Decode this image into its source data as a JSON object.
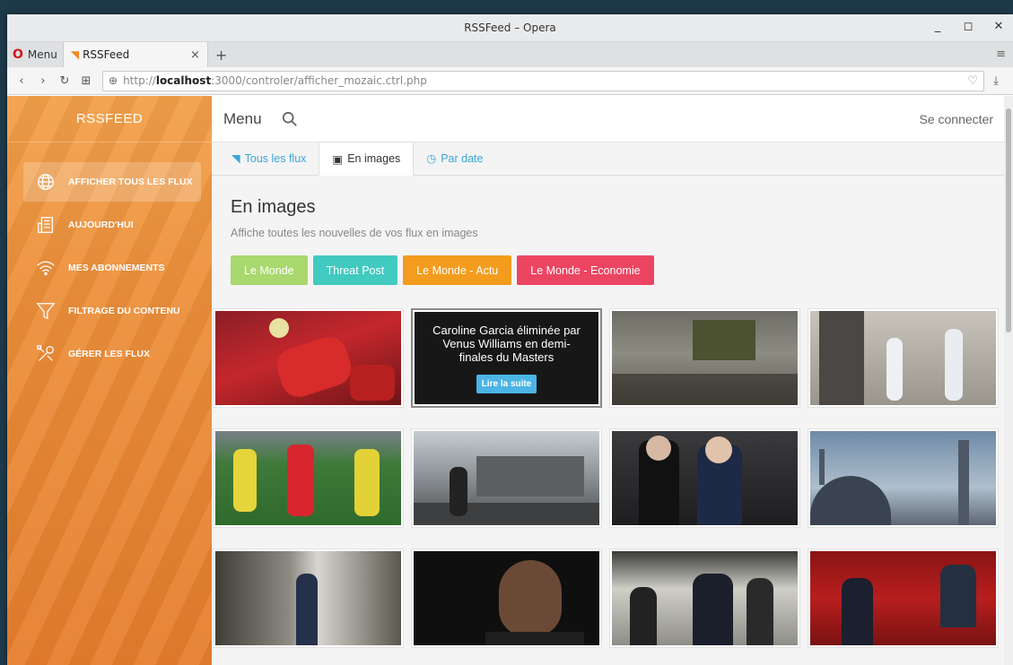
{
  "window": {
    "title": "RSSFeed – Opera"
  },
  "browser": {
    "menu_label": "Menu",
    "tab": {
      "title": "RSSFeed",
      "close": "×"
    },
    "new_tab": "+",
    "url": {
      "prefix": "http://",
      "host": "localhost",
      "rest": ":3000/controler/afficher_mozaic.ctrl.php"
    }
  },
  "sidebar": {
    "brand": "RSSFEED",
    "items": [
      {
        "label": "AFFICHER TOUS LES FLUX",
        "icon": "globe-icon",
        "active": true
      },
      {
        "label": "AUJOURD'HUI",
        "icon": "newspaper-icon",
        "active": false
      },
      {
        "label": "MES ABONNEMENTS",
        "icon": "wifi-icon",
        "active": false
      },
      {
        "label": "FILTRAGE DU CONTENU",
        "icon": "filter-icon",
        "active": false
      },
      {
        "label": "GÉRER LES FLUX",
        "icon": "tools-icon",
        "active": false
      }
    ]
  },
  "topnav": {
    "menu": "Menu",
    "login": "Se connecter"
  },
  "tabs": [
    {
      "label": "Tous les flux",
      "icon": "rss-icon",
      "active": false
    },
    {
      "label": "En images",
      "icon": "image-icon",
      "active": true
    },
    {
      "label": "Par date",
      "icon": "clock-icon",
      "active": false
    }
  ],
  "heading": {
    "title": "En images",
    "subtitle": "Affiche toutes les nouvelles de vos flux en images"
  },
  "filters": [
    {
      "label": "Le Monde",
      "color": "#a9d86e"
    },
    {
      "label": "Threat Post",
      "color": "#41cac0"
    },
    {
      "label": "Le Monde - Actu",
      "color": "#f39c1d"
    },
    {
      "label": "Le Monde - Economie",
      "color": "#ec4561"
    }
  ],
  "hover_card": {
    "title": "Caroline Garcia éliminée par Venus Williams en demi-finales du Masters",
    "cta": "Lire la suite"
  },
  "colors": {
    "sidebar": "#ec8f3a",
    "accent": "#3aa6d8"
  }
}
